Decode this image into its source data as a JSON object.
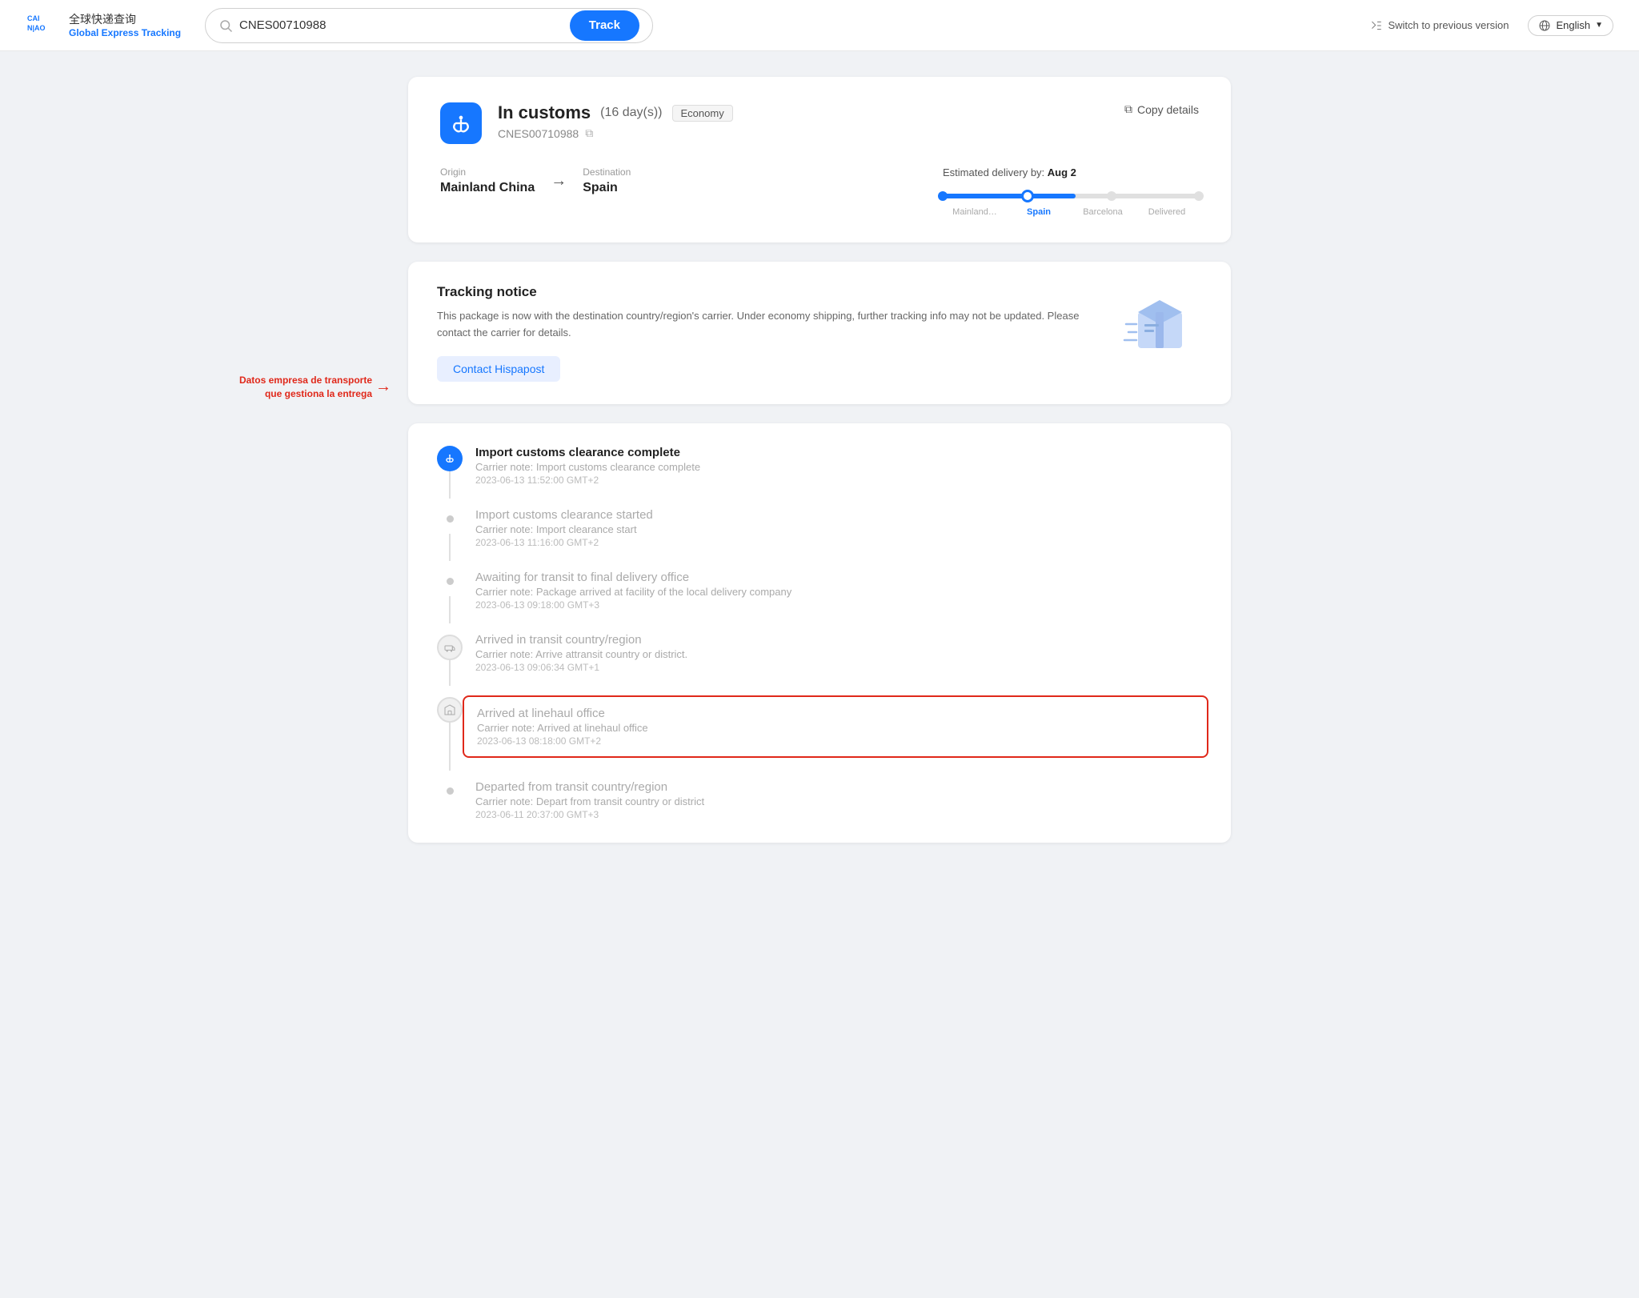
{
  "header": {
    "logo_cn": "全球快递查询",
    "logo_en": "Global Express Tracking",
    "search_value": "CNES00710988",
    "track_btn": "Track",
    "switch_version": "Switch to previous version",
    "language": "English"
  },
  "package": {
    "status": "In customs",
    "days": "(16 day(s))",
    "badge": "Economy",
    "tracking_number": "CNES00710988",
    "copy_details": "Copy details",
    "origin_label": "Origin",
    "origin": "Mainland China",
    "destination_label": "Destination",
    "destination": "Spain",
    "estimated_label": "Estimated delivery by:",
    "estimated_date": "Aug 2",
    "progress_steps": [
      "Mainland…",
      "Spain",
      "Barcelona",
      "Delivered"
    ],
    "active_step": 1
  },
  "notice": {
    "title": "Tracking notice",
    "text": "This package is now with the destination country/region's carrier. Under economy shipping, further tracking info may not be updated. Please contact the carrier for details.",
    "contact_btn": "Contact Hispapost"
  },
  "annotation": {
    "label": "Datos empresa de transporte que gestiona la entrega"
  },
  "timeline": [
    {
      "icon_type": "blue",
      "title": "Import customs clearance complete",
      "note": "Carrier note: Import customs clearance complete",
      "time": "2023-06-13 11:52:00 GMT+2",
      "highlighted": false,
      "gray": false
    },
    {
      "icon_type": "dot",
      "title": "Import customs clearance started",
      "note": "Carrier note: Import clearance start",
      "time": "2023-06-13 11:16:00 GMT+2",
      "highlighted": false,
      "gray": true
    },
    {
      "icon_type": "dot",
      "title": "Awaiting for transit to final delivery office",
      "note": "Carrier note: Package arrived at facility of the local delivery company",
      "time": "2023-06-13 09:18:00 GMT+3",
      "highlighted": false,
      "gray": true
    },
    {
      "icon_type": "gray",
      "title": "Arrived in transit country/region",
      "note": "Carrier note: Arrive attransit country or district.",
      "time": "2023-06-13 09:06:34 GMT+1",
      "highlighted": false,
      "gray": true
    },
    {
      "icon_type": "gray",
      "title": "Arrived at linehaul office",
      "note": "Carrier note: Arrived at linehaul office",
      "time": "2023-06-13 08:18:00 GMT+2",
      "highlighted": true,
      "gray": true
    },
    {
      "icon_type": "dot",
      "title": "Departed from transit country/region",
      "note": "Carrier note: Depart from transit country or district",
      "time": "2023-06-11 20:37:00 GMT+3",
      "highlighted": false,
      "gray": true
    }
  ]
}
